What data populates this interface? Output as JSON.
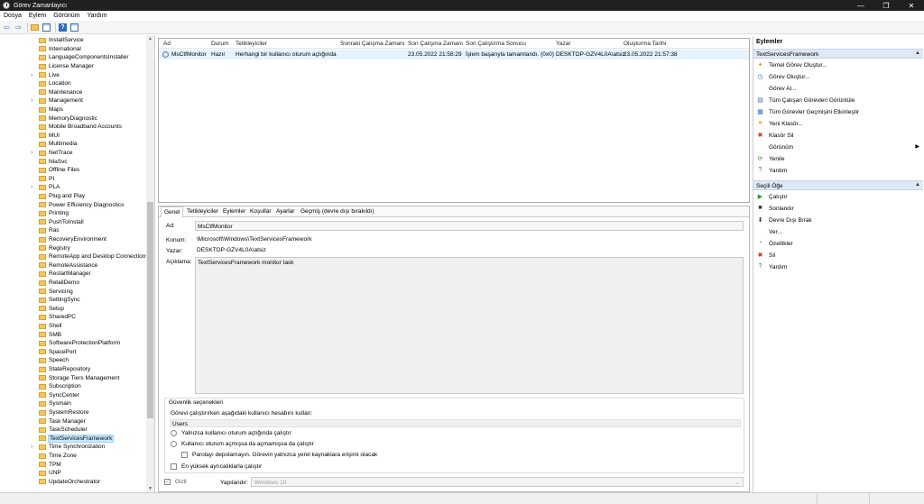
{
  "window": {
    "title": "Görev Zamanlayıcı",
    "controls": [
      "—",
      "❐",
      "✕"
    ]
  },
  "menu": [
    "Dosya",
    "Eylem",
    "Görünüm",
    "Yardım"
  ],
  "toolbar": {
    "back": "⇦",
    "forward": "⇨"
  },
  "tree": {
    "items": [
      {
        "label": "InstallService",
        "expandable": false
      },
      {
        "label": "International",
        "expandable": false
      },
      {
        "label": "LanguageComponentsInstaller",
        "expandable": false
      },
      {
        "label": "License Manager",
        "expandable": false
      },
      {
        "label": "Live",
        "expandable": true
      },
      {
        "label": "Location",
        "expandable": false
      },
      {
        "label": "Maintenance",
        "expandable": false
      },
      {
        "label": "Management",
        "expandable": true
      },
      {
        "label": "Maps",
        "expandable": false
      },
      {
        "label": "MemoryDiagnostic",
        "expandable": false
      },
      {
        "label": "Mobile Broadband Accounts",
        "expandable": false
      },
      {
        "label": "MUI",
        "expandable": false
      },
      {
        "label": "Multimedia",
        "expandable": false
      },
      {
        "label": "NetTrace",
        "expandable": true
      },
      {
        "label": "NlaSvc",
        "expandable": false
      },
      {
        "label": "Offline Files",
        "expandable": false
      },
      {
        "label": "PI",
        "expandable": false
      },
      {
        "label": "PLA",
        "expandable": true
      },
      {
        "label": "Plug and Play",
        "expandable": false
      },
      {
        "label": "Power Efficiency Diagnostics",
        "expandable": false
      },
      {
        "label": "Printing",
        "expandable": false
      },
      {
        "label": "PushToInstall",
        "expandable": false
      },
      {
        "label": "Ras",
        "expandable": false
      },
      {
        "label": "RecoveryEnvironment",
        "expandable": false
      },
      {
        "label": "Registry",
        "expandable": false
      },
      {
        "label": "RemoteApp and Desktop Connections",
        "expandable": false
      },
      {
        "label": "RemoteAssistance",
        "expandable": false
      },
      {
        "label": "RestartManager",
        "expandable": false
      },
      {
        "label": "RetailDemo",
        "expandable": false
      },
      {
        "label": "Servicing",
        "expandable": false
      },
      {
        "label": "SettingSync",
        "expandable": false
      },
      {
        "label": "Setup",
        "expandable": false
      },
      {
        "label": "SharedPC",
        "expandable": false
      },
      {
        "label": "Shell",
        "expandable": false
      },
      {
        "label": "SMB",
        "expandable": false
      },
      {
        "label": "SoftwareProtectionPlatform",
        "expandable": false
      },
      {
        "label": "SpacePort",
        "expandable": false
      },
      {
        "label": "Speech",
        "expandable": false
      },
      {
        "label": "StateRepository",
        "expandable": false
      },
      {
        "label": "Storage Tiers Management",
        "expandable": false
      },
      {
        "label": "Subscription",
        "expandable": false
      },
      {
        "label": "SyncCenter",
        "expandable": false
      },
      {
        "label": "Sysmain",
        "expandable": false
      },
      {
        "label": "SystemRestore",
        "expandable": false
      },
      {
        "label": "Task Manager",
        "expandable": false
      },
      {
        "label": "TaskScheduler",
        "expandable": false
      },
      {
        "label": "TextServicesFramework",
        "expandable": false,
        "selected": true
      },
      {
        "label": "Time Synchronization",
        "expandable": true
      },
      {
        "label": "Time Zone",
        "expandable": false
      },
      {
        "label": "TPM",
        "expandable": false
      },
      {
        "label": "UNP",
        "expandable": false
      },
      {
        "label": "UpdateOrchestrator",
        "expandable": false
      }
    ]
  },
  "tasklist": {
    "columns": [
      "Ad",
      "Durum",
      "Tetikleyiciler",
      "Sonraki Çalışma Zamanı",
      "Son Çalışma Zamanı",
      "Son Çalıştırma Sonucu",
      "Yazar",
      "Oluşturma Tarihi"
    ],
    "rows": [
      {
        "name": "MsCtfMonitor",
        "status": "Hazır",
        "triggers": "Herhangi bir kullanıcı oturum açtığında",
        "next_run": "",
        "last_run": "23.05.2022 21:58:29",
        "last_result": "İşlem başarıyla tamamlandı. (0x0)",
        "author": "DESKTOP-GZV4L0A\\atsiz",
        "created": "23.05.2022 21:57:38"
      }
    ]
  },
  "details": {
    "tabs": [
      "Genel",
      "Tetikleyiciler",
      "Eylemler",
      "Koşullar",
      "Ayarlar",
      "Geçmiş (devre dışı bırakıldı)"
    ],
    "name_label": "Ad:",
    "name_value": "MsCtfMonitor",
    "location_label": "Konum:",
    "location_value": "\\Microsoft\\Windows\\TextServicesFramework",
    "author_label": "Yazar:",
    "author_value": "DESKTOP-GZV4L0A\\atsiz",
    "desc_label": "Açıklama:",
    "desc_value": "TextServicesFramework monitor task",
    "security": {
      "title": "Güvenlik seçenekleri",
      "run_as_label": "Görevi çalıştırırken aşağıdaki kullanıcı hesabını kullan:",
      "run_as_value": "Users",
      "opt_logged_on": "Yalnızca kullanıcı oturum açtığında çalıştır",
      "opt_logged_or_not": "Kullanıcı oturum açmışsa da açmamışsa da çalıştır",
      "opt_no_password": "Parolayı depolamayın. Görevin yalnızca yerel kaynaklara erişimi olacak",
      "opt_highest": "En yüksek ayrıcalıklarla çalıştır"
    },
    "hidden_label": "Gizli",
    "configure_label": "Yapılandır:",
    "configure_value": "Windows 10"
  },
  "actions": {
    "header": "Eylemler",
    "section1": "TextServicesFramework",
    "items1": [
      {
        "label": "Temel Görev Oluştur...",
        "icon": "wand-icon",
        "glyph": "✦",
        "color": "#d59b1a"
      },
      {
        "label": "Görev Oluştur...",
        "icon": "task-icon",
        "glyph": "◷",
        "color": "#3a6cb5"
      },
      {
        "label": "Görev Al...",
        "icon": "",
        "glyph": "",
        "color": "#000"
      },
      {
        "label": "Tüm Çalışan Görevleri Görüntüle",
        "icon": "list-icon",
        "glyph": "▤",
        "color": "#3a6cb5"
      },
      {
        "label": "Tüm Görevler Geçmişini Etkinleştir",
        "icon": "history-icon",
        "glyph": "▦",
        "color": "#3a6cb5"
      },
      {
        "label": "Yeni Klasör...",
        "icon": "folder-icon",
        "glyph": "■",
        "color": "#f4c45a"
      },
      {
        "label": "Klasör Sil",
        "icon": "delete-icon",
        "glyph": "✖",
        "color": "#d42a1c"
      },
      {
        "label": "Görünüm",
        "icon": "",
        "glyph": "",
        "color": "#000",
        "submenu": true
      },
      {
        "label": "Yenile",
        "icon": "refresh-icon",
        "glyph": "⟳",
        "color": "#3a8a3a"
      },
      {
        "label": "Yardım",
        "icon": "help-icon",
        "glyph": "?",
        "color": "#2d6cc0"
      }
    ],
    "section2": "Seçili Öğe",
    "items2": [
      {
        "label": "Çalıştır",
        "icon": "play-icon",
        "glyph": "▶",
        "color": "#2a9a2a"
      },
      {
        "label": "Sonlandır",
        "icon": "stop-icon",
        "glyph": "■",
        "color": "#333"
      },
      {
        "label": "Devre Dışı Bırak",
        "icon": "disable-icon",
        "glyph": "⬇",
        "color": "#333"
      },
      {
        "label": "Ver...",
        "icon": "",
        "glyph": "",
        "color": "#000"
      },
      {
        "label": "Özellikler",
        "icon": "properties-icon",
        "glyph": "◔",
        "color": "#666"
      },
      {
        "label": "Sil",
        "icon": "delete-icon",
        "glyph": "✖",
        "color": "#d42a1c"
      },
      {
        "label": "Yardım",
        "icon": "help-icon",
        "glyph": "?",
        "color": "#2d6cc0"
      }
    ]
  }
}
